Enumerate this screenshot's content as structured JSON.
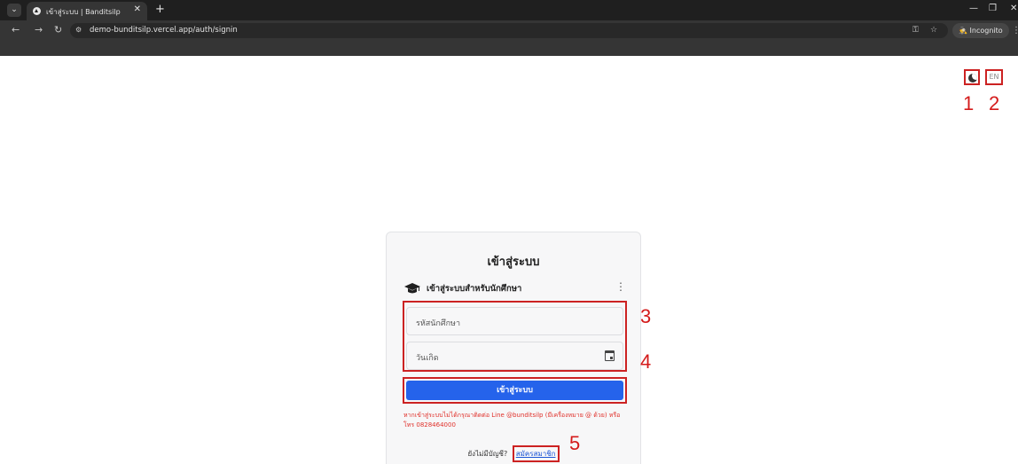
{
  "browser": {
    "tab_title": "เข้าสู่ระบบ | Banditsilp",
    "url": "demo-bunditsilp.vercel.app/auth/signin",
    "incognito_label": "Incognito"
  },
  "top_controls": {
    "theme_icon": "moon-icon",
    "lang_label": "EN"
  },
  "annotations": [
    "1",
    "2",
    "3",
    "4",
    "5"
  ],
  "card": {
    "title": "เข้าสู่ระบบ",
    "mode_label": "เข้าสู่ระบบสำหรับนักศึกษา",
    "student_id_placeholder": "รหัสนักศึกษา",
    "birthdate_placeholder": "วันเกิด",
    "submit_label": "เข้าสู่ระบบ",
    "help_text": "หากเข้าสู่ระบบไม่ได้กรุณาติดต่อ Line @bunditsilp (มีเครื่องหมาย @ ด้วย) หรือโทร 0828464000",
    "signup_prompt": "ยังไม่มีบัญชี?",
    "signup_link": "สมัครสมาชิก"
  },
  "colors": {
    "accent": "#2563eb",
    "annotation": "#d41b1b",
    "help_text": "#e0302a"
  }
}
